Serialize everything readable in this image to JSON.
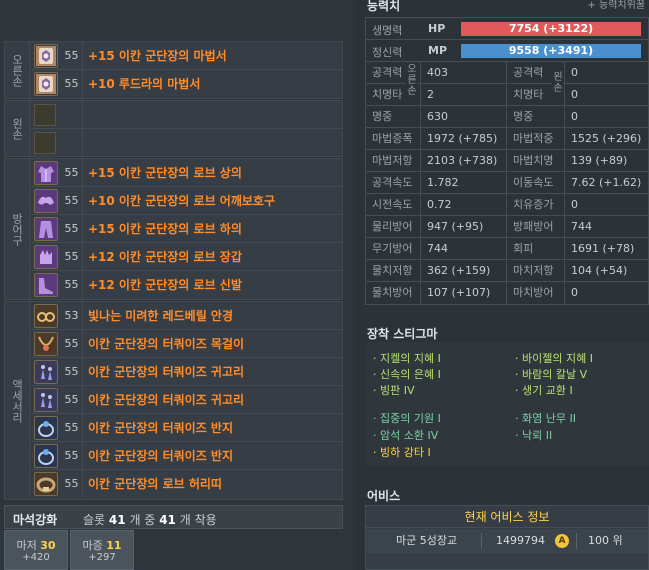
{
  "equipment": {
    "right_hand_label": "오른손",
    "left_hand_label": "왼손",
    "armor_label": "방어구",
    "accessory_label": "액세서리",
    "right_hand": [
      {
        "level": "55",
        "name": "+15 이칸 군단장의 마법서",
        "icon": "spellbook-icon"
      },
      {
        "level": "55",
        "name": "+10 루드라의 마법서",
        "icon": "spellbook-icon"
      }
    ],
    "armor": [
      {
        "level": "55",
        "name": "+15 이칸 군단장의 로브 상의",
        "icon": "robe-top-icon"
      },
      {
        "level": "55",
        "name": "+10 이칸 군단장의 로브 어깨보호구",
        "icon": "shoulder-icon"
      },
      {
        "level": "55",
        "name": "+15 이칸 군단장의 로브 하의",
        "icon": "robe-pants-icon"
      },
      {
        "level": "55",
        "name": "+12 이칸 군단장의 로브 장갑",
        "icon": "gloves-icon"
      },
      {
        "level": "55",
        "name": "+12 이칸 군단장의 로브 신발",
        "icon": "shoes-icon"
      }
    ],
    "accessories": [
      {
        "level": "53",
        "name": "빛나는 미려한 레드베릴 안경",
        "icon": "glasses-icon"
      },
      {
        "level": "55",
        "name": "이칸 군단장의 터쿼이즈 목걸이",
        "icon": "necklace-icon"
      },
      {
        "level": "55",
        "name": "이칸 군단장의 터쿼이즈 귀고리",
        "icon": "earring-icon"
      },
      {
        "level": "55",
        "name": "이칸 군단장의 터쿼이즈 귀고리",
        "icon": "earring-icon"
      },
      {
        "level": "55",
        "name": "이칸 군단장의 터쿼이즈 반지",
        "icon": "ring-icon"
      },
      {
        "level": "55",
        "name": "이칸 군단장의 터쿼이즈 반지",
        "icon": "ring-icon"
      },
      {
        "level": "55",
        "name": "이칸 군단장의 로브 허리띠",
        "icon": "belt-icon"
      }
    ],
    "item_name_color": "#ff8c2a"
  },
  "manastone": {
    "title": "마석강화",
    "slot_prefix": "슬롯",
    "slot_total": "41",
    "slot_mid": "개 중",
    "slot_used": "41",
    "slot_suffix": "개 착용",
    "boxes": [
      {
        "label": "마저",
        "value": "30",
        "bonus": "+420"
      },
      {
        "label": "마증",
        "value": "11",
        "bonus": "+297"
      }
    ]
  },
  "stats": {
    "header": "능력치",
    "wiki_link": "+ 능력치위꿀",
    "hp": {
      "label": "생명력",
      "tag": "HP",
      "value": "7754 (+3122)",
      "color": "#e05a5a"
    },
    "mp": {
      "label": "정신력",
      "tag": "MP",
      "value": "9558 (+3491)",
      "color": "#4a90cf"
    },
    "sub_right_hand": "오른손",
    "sub_left_hand": "왼손",
    "rows_hand": [
      {
        "l1": "공격력",
        "v1": "403",
        "l2": "공격력",
        "v2": "0"
      },
      {
        "l1": "치명타",
        "v1": "2",
        "l2": "치명타",
        "v2": "0"
      },
      {
        "l1": "명중",
        "v1": "630",
        "l2": "명중",
        "v2": "0"
      }
    ],
    "rows": [
      {
        "l1": "마법증폭",
        "v1": "1972 (+785)",
        "l2": "마법적중",
        "v2": "1525 (+296)"
      },
      {
        "l1": "마법저항",
        "v1": "2103 (+738)",
        "l2": "마법치명",
        "v2": "139 (+89)"
      },
      {
        "l1": "공격속도",
        "v1": "1.782",
        "l2": "이동속도",
        "v2": "7.62 (+1.62)"
      },
      {
        "l1": "시전속도",
        "v1": "0.72",
        "l2": "치유증가",
        "v2": "0"
      },
      {
        "l1": "물리방어",
        "v1": "947 (+95)",
        "l2": "방패방어",
        "v2": "744"
      },
      {
        "l1": "무기방어",
        "v1": "744",
        "l2": "회피",
        "v2": "1691 (+78)"
      },
      {
        "l1": "물치저항",
        "v1": "362 (+159)",
        "l2": "마치저항",
        "v2": "104 (+54)"
      },
      {
        "l1": "물치방어",
        "v1": "107 (+107)",
        "l2": "마치방어",
        "v2": "0"
      }
    ]
  },
  "stigma": {
    "title": "장착 스티그마",
    "items": [
      {
        "text": "· 지켈의 지혜 I",
        "kind": "normal"
      },
      {
        "text": "· 바이젤의 지혜 I",
        "kind": "normal"
      },
      {
        "text": "· 신속의 은혜 I",
        "kind": "normal"
      },
      {
        "text": "· 바람의 칼날 V",
        "kind": "normal"
      },
      {
        "text": "· 빙판 IV",
        "kind": "normal"
      },
      {
        "text": "· 생기 교환 I",
        "kind": "normal"
      },
      {
        "text": "· 집중의 기원 I",
        "kind": "alt"
      },
      {
        "text": "· 화염 난무 II",
        "kind": "alt"
      },
      {
        "text": "· 암석 소환 IV",
        "kind": "alt"
      },
      {
        "text": "· 낙뢰 II",
        "kind": "alt"
      },
      {
        "text": "· 빙하 강타 I",
        "kind": "gold"
      }
    ]
  },
  "abyss": {
    "title": "어비스",
    "info_title": "현재 어비스 정보",
    "rank": "마군 5성장교",
    "points": "1499794",
    "point_icon": "abyss-point-icon",
    "point_icon_glyph": "A",
    "position": "100 위"
  }
}
